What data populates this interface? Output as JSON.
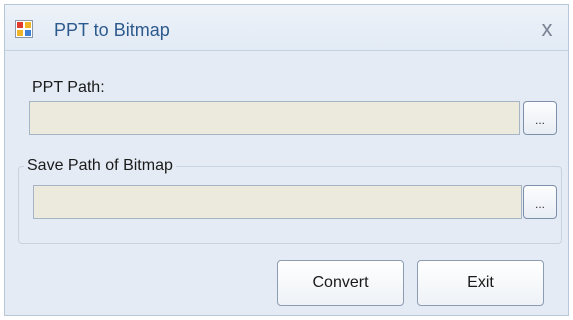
{
  "window": {
    "title": "PPT to Bitmap",
    "close_label": "x"
  },
  "ppt_path": {
    "label": "PPT Path:",
    "value": "",
    "browse_label": "..."
  },
  "save_path": {
    "group_label": "Save Path of Bitmap",
    "value": "",
    "browse_label": "..."
  },
  "actions": {
    "convert_label": "Convert",
    "exit_label": "Exit"
  },
  "icons": {
    "app": "application-icon",
    "close": "close-icon"
  },
  "colors": {
    "window_bg": "#e4ebf4",
    "title_text": "#2d5a8e",
    "input_bg": "#ece9dd"
  }
}
